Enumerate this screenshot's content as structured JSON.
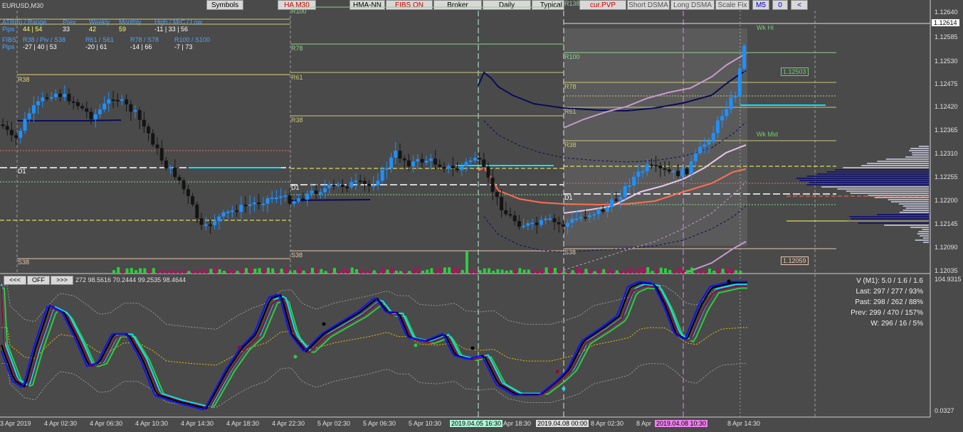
{
  "chart_title": "EURUSD,M30",
  "toolbar": {
    "symbols": "Symbols",
    "ha": "HA M30",
    "hma": "HMA-NN",
    "fibs": "FIBS ON",
    "broker": "Broker",
    "daily": "Daily",
    "typical": "Typical",
    "curpvp": "cur.PVP",
    "short_dsma": "Short DSMA",
    "long_dsma": "Long DSMA",
    "scale_fix": "Scale Fix",
    "tf": "M5",
    "zero": "0",
    "back": "<"
  },
  "info_panel": {
    "row1_label": "ATR(5) / Range",
    "row1_cols": [
      "Prev",
      "Weekly",
      "Monthly",
      "High / MrC / Low"
    ],
    "pips_label": "Pips",
    "row1_vals": [
      "44 | 54",
      "33",
      "42",
      "59",
      "-11 | 33 | 56"
    ],
    "row2_label": "FIBS",
    "row2_cols": [
      "R38 / Piv / S38",
      "R61 / S61",
      "R78 / S78",
      "R100 / S100"
    ],
    "row2_vals": [
      "-27 | 40 | 53",
      "-20 | 61",
      "-14 | 66",
      "-7 | 73"
    ]
  },
  "levels": {
    "r38_left": "R38",
    "d1_left": "D1",
    "s38_left": "S38",
    "r100": "R100",
    "r78": "R78",
    "r61": "R61",
    "r38": "R38",
    "d1": "D1",
    "s38": "S38",
    "r138": "R138",
    "r100_b": "R100",
    "r78_b": "R78",
    "r61_b": "R61",
    "r38_b": "R38",
    "d1_b": "D1",
    "s38_b": "S38",
    "wk_hi": "Wk Hi",
    "wk_mid": "Wk Mid",
    "price_box_1": "1.12503",
    "price_box_2": "1.12059"
  },
  "price_axis": {
    "ticks": [
      "1.12640",
      "1.12585",
      "1.12530",
      "1.12475",
      "1.12420",
      "1.12365",
      "1.12310",
      "1.12255",
      "1.12200",
      "1.12145",
      "1.12090",
      "1.12035"
    ],
    "current": "1.12614"
  },
  "oscillator": {
    "nav_prev": "<<<",
    "nav_off": "OFF",
    "nav_next": ">>>",
    "values_text": "272 98.5616 70.2444 99.2535 98.4644",
    "axis_top": "104.9315",
    "axis_bottom": "0.0327",
    "stats": [
      "V (M1): 5.0 / 1.6 / 1.6",
      "Last: 297 / 277 / 93%",
      "Past: 298 / 262 / 88%",
      "Prev: 299 / 470 / 157%",
      "W: 296 / 16 / 5%"
    ]
  },
  "time_axis": {
    "ticks": [
      "3 Apr 2019",
      "4 Apr 02:30",
      "4 Apr 06:30",
      "4 Apr 10:30",
      "4 Apr 14:30",
      "4 Apr 18:30",
      "4 Apr 22:30",
      "5 Apr 02:30",
      "5 Apr 06:30",
      "5 Apr 10:30",
      "5 Apr 18:30",
      "8 Apr 02:30",
      "8 Apr",
      "8 Apr 14:30"
    ],
    "marker1": "2019.04.05 16:30",
    "marker2": "2019.04.08 00:00",
    "marker3": "2019.04.08 10:30"
  },
  "colors": {
    "background": "#4a4a4a",
    "bull": "#1e90ff",
    "bear": "#141414",
    "accent_cyan": "#00e5ff",
    "fib_line": "#c8c87a"
  }
}
